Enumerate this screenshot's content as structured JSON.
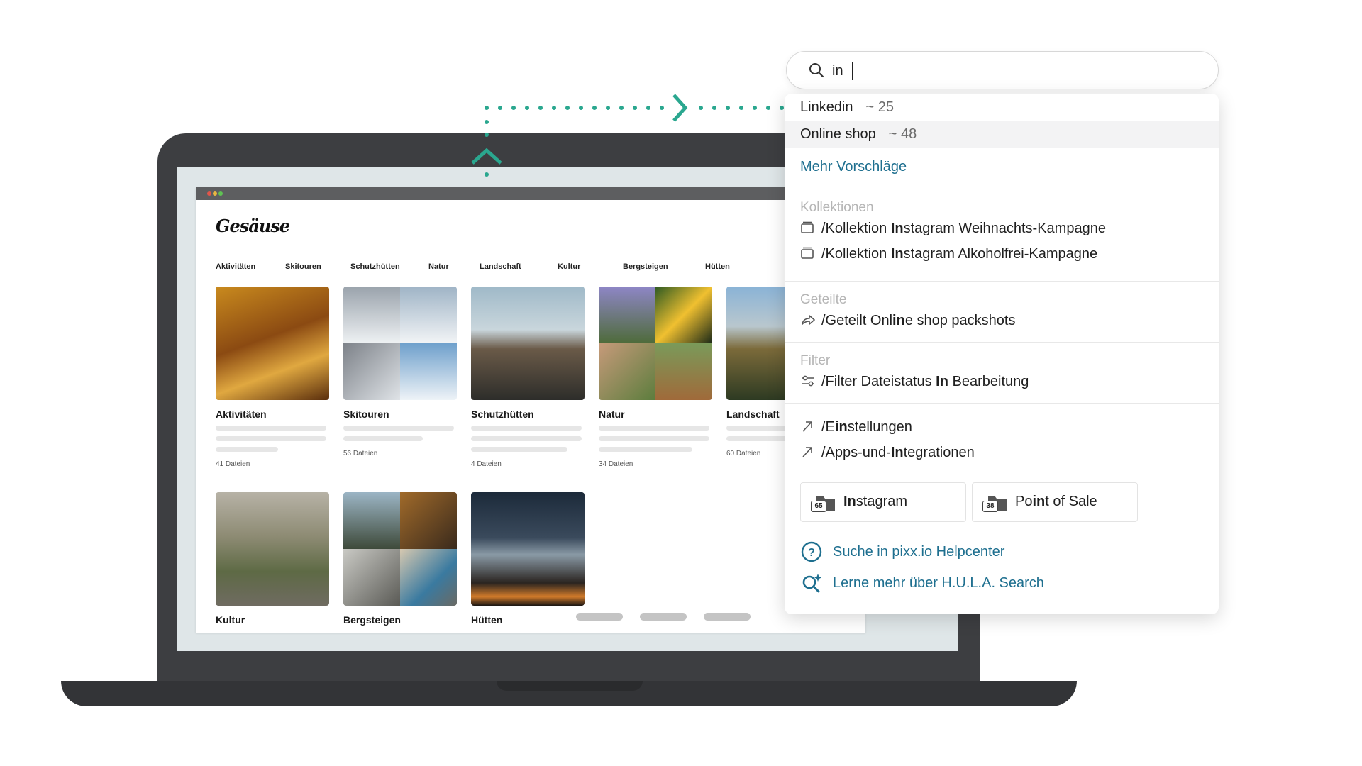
{
  "app": {
    "brand": "Gesäuse",
    "nav": [
      "Aktivitäten",
      "Skitouren",
      "Schutzhütten",
      "Natur",
      "Landschaft",
      "Kultur",
      "Bergsteigen",
      "Hütten"
    ],
    "tiles": [
      {
        "name": "Aktivitäten",
        "count": "41 Dateien"
      },
      {
        "name": "Skitouren",
        "count": "56 Dateien"
      },
      {
        "name": "Schutzhütten",
        "count": "4 Dateien"
      },
      {
        "name": "Natur",
        "count": "34 Dateien"
      },
      {
        "name": "Landschaft",
        "count": "60 Dateien"
      },
      {
        "name": "Kultur"
      },
      {
        "name": "Bergsteigen"
      },
      {
        "name": "Hütten"
      }
    ]
  },
  "search": {
    "query": "in"
  },
  "suggestions": [
    {
      "label": "Linkedin",
      "count": "~ 25"
    },
    {
      "label": "Online shop",
      "count": "~ 48"
    }
  ],
  "more_suggestions": "Mehr Vorschläge",
  "sections": {
    "collections": {
      "title": "Kollektionen",
      "items": [
        {
          "pre": "/Kollektion ",
          "bold": "In",
          "post": "stagram Weihnachts-Kampagne"
        },
        {
          "pre": "/Kollektion ",
          "bold": "In",
          "post": "stagram Alkoholfrei-Kampagne"
        }
      ]
    },
    "shared": {
      "title": "Geteilte",
      "items": [
        {
          "pre": "/Geteilt Onl",
          "bold": "in",
          "post": "e shop packshots"
        }
      ]
    },
    "filter": {
      "title": "Filter",
      "items": [
        {
          "pre": "/Filter Dateistatus ",
          "bold": "In",
          "post": " Bearbeitung"
        }
      ]
    },
    "pages": {
      "items": [
        {
          "pre": "/E",
          "bold": "in",
          "post": "stellungen"
        },
        {
          "pre": "/Apps-und-",
          "bold": "In",
          "post": "tegrationen"
        }
      ]
    }
  },
  "quick_folders": [
    {
      "badge": "65",
      "pre": "",
      "bold": "In",
      "post": "stagram"
    },
    {
      "badge": "38",
      "pre": "Po",
      "bold": "in",
      "post": "t of Sale"
    }
  ],
  "help": [
    {
      "label": "Suche in pixx.io Helpcenter",
      "icon": "help-circle-icon"
    },
    {
      "label": "Lerne mehr über H.U.L.A. Search",
      "icon": "ai-search-icon"
    }
  ],
  "colors": {
    "accent_teal": "#2aa78f",
    "link": "#1e6f8f",
    "laptop": "#3d3e41"
  }
}
